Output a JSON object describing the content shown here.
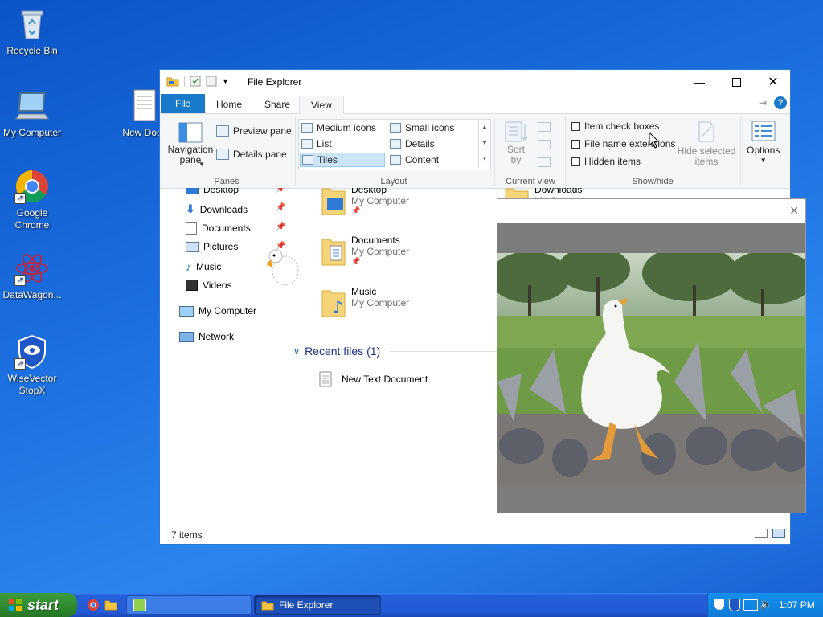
{
  "desktop": {
    "icons": [
      {
        "label": "Recycle Bin"
      },
      {
        "label": "My Computer"
      },
      {
        "label": "Google Chrome"
      },
      {
        "label": "DataWagon..."
      },
      {
        "label": "WiseVector StopX"
      },
      {
        "label": "New Docu"
      }
    ]
  },
  "explorer": {
    "title": "File Explorer",
    "tabs": [
      "File",
      "Home",
      "Share",
      "View"
    ],
    "active_tab": "View",
    "ribbon": {
      "panes": {
        "navigation_pane": "Navigation pane",
        "preview_pane": "Preview pane",
        "details_pane": "Details pane",
        "label": "Panes"
      },
      "layout": {
        "options": [
          "Medium icons",
          "Small icons",
          "List",
          "Details",
          "Tiles",
          "Content"
        ],
        "selected": "Tiles",
        "label": "Layout"
      },
      "current_view": {
        "sort_by": "Sort by",
        "label": "Current view"
      },
      "show_hide": {
        "item_check_boxes": "Item check boxes",
        "file_name_extensions": "File name extensions",
        "hidden_items": "Hidden items",
        "hide_selected": "Hide selected items",
        "label": "Show/hide"
      },
      "options": "Options"
    },
    "nav": {
      "quick_access": [
        "Desktop",
        "Downloads",
        "Documents",
        "Pictures",
        "Music",
        "Videos"
      ],
      "my_computer": "My Computer",
      "network": "Network"
    },
    "content": {
      "folders": [
        {
          "name": "Desktop",
          "location": "My Computer"
        },
        {
          "name": "Downloads",
          "location": "My Computer"
        },
        {
          "name": "Documents",
          "location": "My Computer"
        },
        {
          "name": "Music",
          "location": "My Computer"
        }
      ],
      "recent_header": "Recent files (1)",
      "recent_files": [
        "New Text Document"
      ]
    },
    "status": "7 items"
  },
  "taskbar": {
    "start": "start",
    "tasks": [
      {
        "label": "File Explorer"
      }
    ],
    "clock": "1:07 PM"
  }
}
